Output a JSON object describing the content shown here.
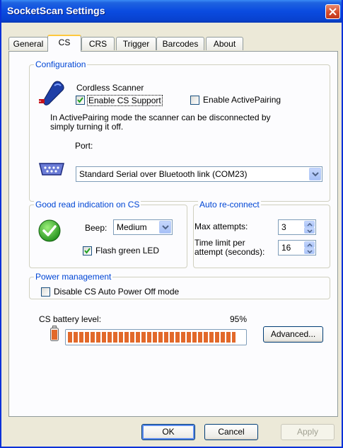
{
  "window": {
    "title": "SocketScan Settings"
  },
  "tabs": [
    "General",
    "CS",
    "CRS",
    "Trigger",
    "Barcodes",
    "About"
  ],
  "active_tab": "CS",
  "configuration": {
    "group_label": "Configuration",
    "device_name": "Cordless Scanner",
    "enable_cs_support": {
      "label": "Enable CS Support",
      "checked": true
    },
    "enable_activepairing": {
      "label": "Enable ActivePairing",
      "checked": false
    },
    "info_line1": "In ActivePairing mode the scanner can be disconnected by",
    "info_line2": "simply turning it off.",
    "port_label": "Port:",
    "port_value": "Standard Serial over Bluetooth link (COM23)"
  },
  "good_read": {
    "group_label": "Good read indication on CS",
    "beep_label": "Beep:",
    "beep_value": "Medium",
    "flash_led": {
      "label": "Flash green LED",
      "checked": true
    }
  },
  "auto_reconnect": {
    "group_label": "Auto re-connect",
    "max_attempts_label": "Max attempts:",
    "max_attempts_value": "3",
    "time_limit_line1": "Time limit per",
    "time_limit_line2": "attempt (seconds):",
    "time_limit_value": "16"
  },
  "power": {
    "group_label": "Power management",
    "disable_auto_off": {
      "label": "Disable CS Auto Power Off mode",
      "checked": false
    }
  },
  "battery": {
    "label": "CS battery level:",
    "percent_text": "95%",
    "level": 0.95
  },
  "buttons": {
    "advanced": "Advanced...",
    "ok": "OK",
    "cancel": "Cancel",
    "apply": "Apply"
  },
  "colors": {
    "title_bar": "#0a4be0",
    "group_label": "#0046d5",
    "battery_fill": "#e2692a",
    "window_bg": "#ece9d8"
  }
}
